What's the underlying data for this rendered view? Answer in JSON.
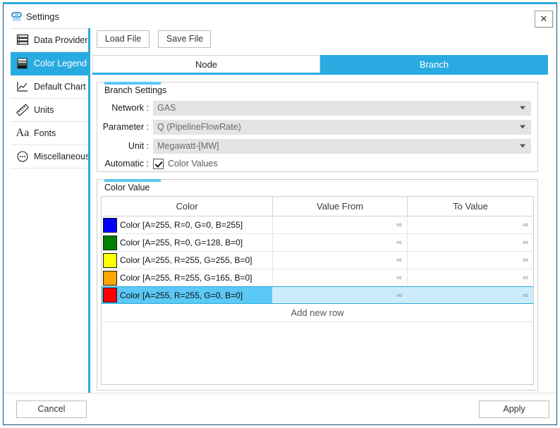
{
  "window": {
    "title": "Settings",
    "app_icon": "chain-link-icon",
    "close_label": "✕",
    "accent_color": "#29ABE2"
  },
  "sidebar": {
    "items": [
      {
        "label": "Data Provider",
        "icon": "server-stack-icon",
        "active": false
      },
      {
        "label": "Color Legend",
        "icon": "color-legend-icon",
        "active": true
      },
      {
        "label": "Default Chart",
        "icon": "line-chart-icon",
        "active": false
      },
      {
        "label": "Units",
        "icon": "ruler-icon",
        "active": false
      },
      {
        "label": "Fonts",
        "icon": "font-aa-icon",
        "active": false
      },
      {
        "label": "Miscellaneous",
        "icon": "ellipsis-circle-icon",
        "active": false
      }
    ]
  },
  "toolbar": {
    "load_file": "Load File",
    "save_file": "Save File"
  },
  "tabs": [
    {
      "label": "Node",
      "active": false
    },
    {
      "label": "Branch",
      "active": true
    }
  ],
  "branch_settings": {
    "title": "Branch Settings",
    "fields": [
      {
        "label": "Network :",
        "value": "GAS"
      },
      {
        "label": "Parameter :",
        "value": "Q (PipelineFlowRate)"
      },
      {
        "label": "Unit :",
        "value": "Megawatt-[MW]"
      }
    ],
    "automatic": {
      "label": "Automatic :",
      "checkbox_label": "Color Values",
      "checked": true
    }
  },
  "color_value": {
    "title": "Color Value",
    "columns": [
      "Color",
      "Value From",
      "To Value"
    ],
    "rows": [
      {
        "swatch": "#0000FF",
        "text": "Color [A=255, R=0, G=0, B=255]",
        "from": "∞",
        "to": "∞",
        "selected": false
      },
      {
        "swatch": "#008000",
        "text": "Color [A=255, R=0, G=128, B=0]",
        "from": "∞",
        "to": "∞",
        "selected": false
      },
      {
        "swatch": "#FFFF00",
        "text": "Color [A=255, R=255, G=255, B=0]",
        "from": "∞",
        "to": "∞",
        "selected": false
      },
      {
        "swatch": "#FFA500",
        "text": "Color [A=255, R=255, G=165, B=0]",
        "from": "∞",
        "to": "∞",
        "selected": false
      },
      {
        "swatch": "#FF0000",
        "text": "Color [A=255, R=255, G=0, B=0]",
        "from": "∞",
        "to": "∞",
        "selected": true
      }
    ],
    "add_new_row": "Add new row"
  },
  "footer": {
    "cancel": "Cancel",
    "apply": "Apply"
  }
}
